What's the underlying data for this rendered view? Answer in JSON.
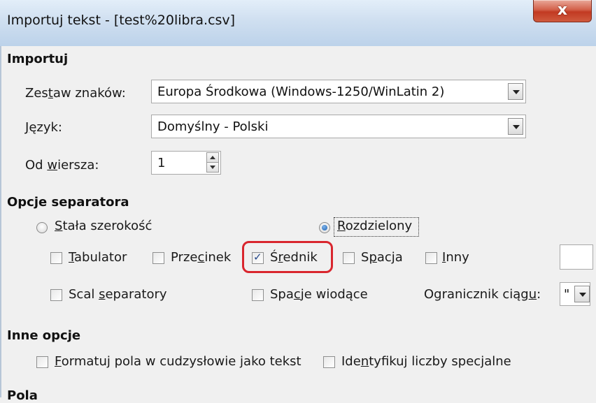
{
  "window": {
    "title": "Importuj tekst - [test%20libra.csv]",
    "close_symbol": "x"
  },
  "import_section": {
    "heading": "Importuj",
    "charset_label": "Zestaw znaków:",
    "charset_value": "Europa Środkowa (Windows-1250/WinLatin 2)",
    "language_label": "Język:",
    "language_value": "Domyślny - Polski",
    "from_row_label": "Od wiersza:",
    "from_row_value": "1"
  },
  "separator_section": {
    "heading": "Opcje separatora",
    "fixed_width_label": "Stała szerokość",
    "separated_label": "Rozdzielony",
    "selected_mode": "separated",
    "tab_label": "Tabulator",
    "comma_label": "Przecinek",
    "semicolon_label": "Średnik",
    "space_label": "Spacja",
    "other_label": "Inny",
    "merge_label": "Scal separatory",
    "leading_spaces_label": "Spacje wiodące",
    "string_delimiter_label": "Ogranicznik ciągu:",
    "string_delimiter_value": "\"",
    "checked": {
      "tab": false,
      "comma": false,
      "semicolon": true,
      "space": false,
      "other": false,
      "merge": false,
      "leading_spaces": false
    }
  },
  "other_options_section": {
    "heading": "Inne opcje",
    "quoted_as_text_label": "Formatuj pola w cudzysłowie jako tekst",
    "detect_special_label": "Identyfikuj liczby specjalne"
  },
  "fields_section": {
    "heading": "Pola"
  },
  "colors": {
    "highlight": "#d9262e",
    "dialog_bg": "#f0f0f0",
    "title_gradient_top": "#e3eef9",
    "close_button": "#c23a22"
  },
  "icons": {
    "close": "close-icon",
    "dropdown": "chevron-down-icon",
    "spin_up": "caret-up-icon",
    "spin_down": "caret-down-icon"
  }
}
